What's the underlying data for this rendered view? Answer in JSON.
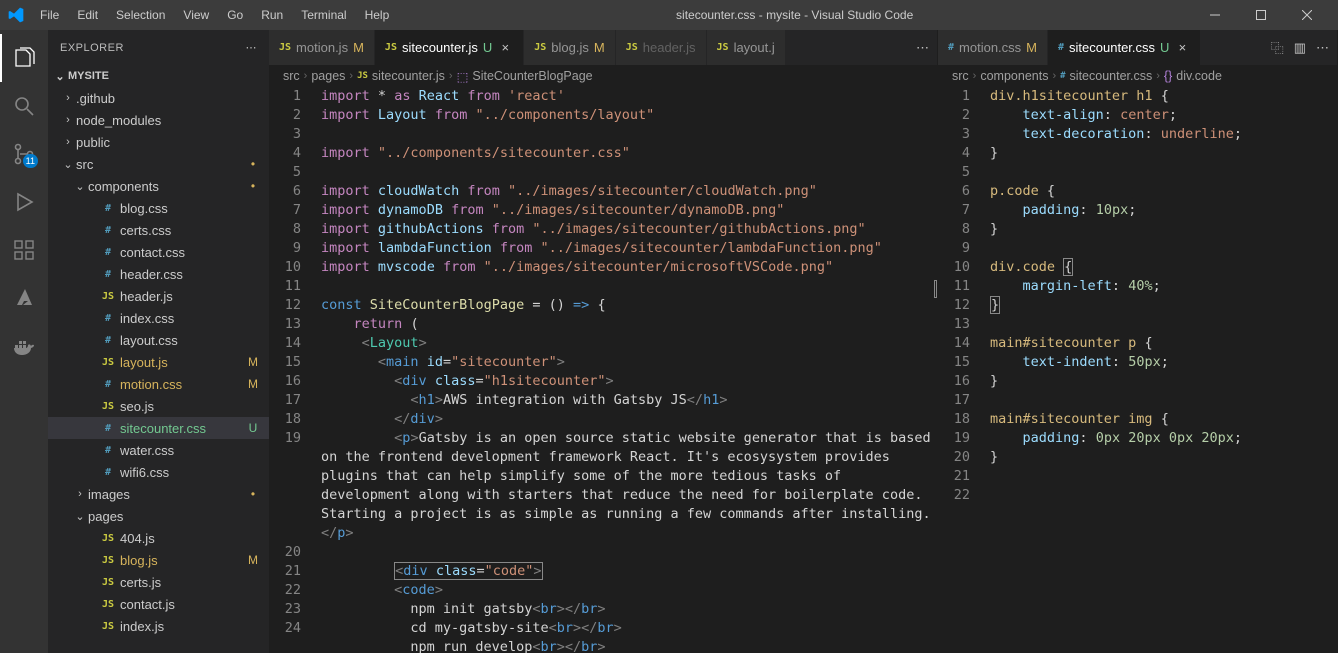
{
  "window": {
    "title": "sitecounter.css - mysite - Visual Studio Code",
    "menus": [
      "File",
      "Edit",
      "Selection",
      "View",
      "Go",
      "Run",
      "Terminal",
      "Help"
    ]
  },
  "activitybar": {
    "items": [
      {
        "name": "files-icon",
        "active": true
      },
      {
        "name": "search-icon"
      },
      {
        "name": "source-control-icon",
        "badge": "11"
      },
      {
        "name": "debug-icon"
      },
      {
        "name": "extensions-icon"
      },
      {
        "name": "azure-icon"
      },
      {
        "name": "docker-icon"
      }
    ]
  },
  "sidebar": {
    "header": "EXPLORER",
    "section": "MYSITE",
    "tree": [
      {
        "d": 1,
        "t": "folder",
        "c": false,
        "label": ".github"
      },
      {
        "d": 1,
        "t": "folder",
        "c": false,
        "label": "node_modules"
      },
      {
        "d": 1,
        "t": "folder",
        "c": false,
        "label": "public"
      },
      {
        "d": 1,
        "t": "folder",
        "c": true,
        "label": "src",
        "git": "•"
      },
      {
        "d": 2,
        "t": "folder",
        "c": true,
        "label": "components",
        "git": "•"
      },
      {
        "d": 3,
        "t": "css",
        "label": "blog.css"
      },
      {
        "d": 3,
        "t": "css",
        "label": "certs.css"
      },
      {
        "d": 3,
        "t": "css",
        "label": "contact.css"
      },
      {
        "d": 3,
        "t": "css",
        "label": "header.css"
      },
      {
        "d": 3,
        "t": "js",
        "label": "header.js"
      },
      {
        "d": 3,
        "t": "css",
        "label": "index.css"
      },
      {
        "d": 3,
        "t": "css",
        "label": "layout.css"
      },
      {
        "d": 3,
        "t": "js",
        "label": "layout.js",
        "git": "M"
      },
      {
        "d": 3,
        "t": "css",
        "label": "motion.css",
        "git": "M"
      },
      {
        "d": 3,
        "t": "js",
        "label": "seo.js"
      },
      {
        "d": 3,
        "t": "css",
        "label": "sitecounter.css",
        "git": "U",
        "sel": true
      },
      {
        "d": 3,
        "t": "css",
        "label": "water.css"
      },
      {
        "d": 3,
        "t": "css",
        "label": "wifi6.css"
      },
      {
        "d": 2,
        "t": "folder",
        "c": false,
        "label": "images",
        "git": "•"
      },
      {
        "d": 2,
        "t": "folder",
        "c": true,
        "label": "pages"
      },
      {
        "d": 3,
        "t": "js",
        "label": "404.js"
      },
      {
        "d": 3,
        "t": "js",
        "label": "blog.js",
        "git": "M"
      },
      {
        "d": 3,
        "t": "js",
        "label": "certs.js"
      },
      {
        "d": 3,
        "t": "js",
        "label": "contact.js"
      },
      {
        "d": 3,
        "t": "js",
        "label": "index.js"
      }
    ]
  },
  "pane1": {
    "tabs": [
      {
        "ic": "JS",
        "iccls": "ic-js",
        "label": "motion.js",
        "git": "M",
        "active": false
      },
      {
        "ic": "JS",
        "iccls": "ic-js",
        "label": "sitecounter.js",
        "git": "U",
        "active": true,
        "close": true
      },
      {
        "ic": "JS",
        "iccls": "ic-js",
        "label": "blog.js",
        "git": "M",
        "active": false
      },
      {
        "ic": "JS",
        "iccls": "ic-js",
        "label": "header.js",
        "git": "",
        "active": false,
        "dim": true
      },
      {
        "ic": "JS",
        "iccls": "ic-js",
        "label": "layout.j",
        "git": "",
        "active": false
      }
    ],
    "actions_more": "⋯",
    "crumbs": [
      "src",
      "pages",
      {
        "ic": "JS",
        "iccls": "ic-js",
        "label": "sitecounter.js"
      },
      {
        "sym": "⬚",
        "label": "SiteCounterBlogPage"
      }
    ]
  },
  "pane2": {
    "tabs": [
      {
        "ic": "#",
        "iccls": "ic-css",
        "label": "motion.css",
        "git": "M",
        "active": false
      },
      {
        "ic": "#",
        "iccls": "ic-css",
        "label": "sitecounter.css",
        "git": "U",
        "active": true,
        "close": true
      }
    ],
    "actions": [
      "⿻",
      "▥",
      "⋯"
    ],
    "crumbs": [
      "src",
      "components",
      {
        "ic": "#",
        "iccls": "ic-css",
        "label": "sitecounter.css"
      },
      {
        "sym": "{}",
        "label": "div.code"
      }
    ]
  },
  "code1_lines": [
    "1",
    "2",
    "3",
    "4",
    "5",
    "6",
    "7",
    "8",
    "9",
    "10",
    "11",
    "12",
    "13",
    "14",
    "15",
    "16",
    "17",
    "18",
    "19",
    "",
    "",
    "",
    "",
    "",
    "20",
    "21",
    "22",
    "23",
    "24",
    ""
  ],
  "code2_lines": [
    "1",
    "2",
    "3",
    "4",
    "5",
    "6",
    "7",
    "8",
    "9",
    "10",
    "11",
    "12",
    "13",
    "14",
    "15",
    "16",
    "17",
    "18",
    "19",
    "20",
    "21",
    "22"
  ]
}
